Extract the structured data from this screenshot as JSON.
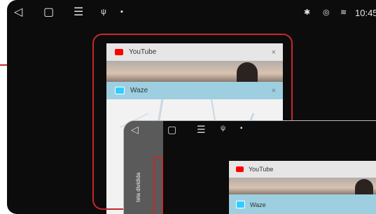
{
  "status_bar": {
    "nav_icons": [
      "back-icon",
      "home-icon",
      "menu-icon",
      "usb-icon",
      "notification-icon"
    ],
    "status_icons": [
      "bluetooth-icon",
      "location-icon",
      "wifi-icon"
    ],
    "time": "10:45"
  },
  "recents": [
    {
      "title": "YouTube",
      "close": "×",
      "icon": "youtube-icon",
      "accent": "#ff0000"
    },
    {
      "title": "Waze",
      "close": "×",
      "icon": "waze-icon",
      "accent": "#33ccff"
    }
  ],
  "zoom_inset": {
    "status_icons": [
      "back-icon",
      "home-icon",
      "menu-icon",
      "usb-icon",
      "notification-icon"
    ],
    "split_label": "tela dividida",
    "recents": [
      {
        "title": "YouTube",
        "icon": "youtube-icon"
      },
      {
        "title": "Waze",
        "icon": "waze-icon"
      }
    ]
  },
  "colors": {
    "highlight": "#c62828",
    "waze_bar": "#9dcfe0",
    "card_bar": "#e6e6e6"
  }
}
